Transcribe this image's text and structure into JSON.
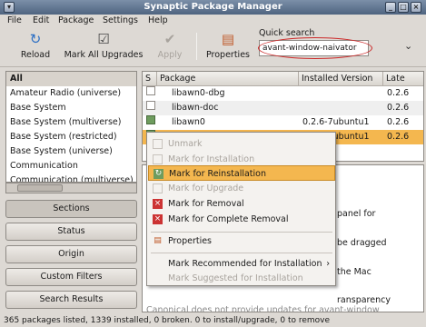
{
  "window": {
    "title": "Synaptic Package Manager"
  },
  "menubar": [
    "File",
    "Edit",
    "Package",
    "Settings",
    "Help"
  ],
  "toolbar": {
    "reload": "Reload",
    "mark_all": "Mark All Upgrades",
    "apply": "Apply",
    "properties": "Properties"
  },
  "search": {
    "label": "Quick search",
    "value": "avant-window-naivator"
  },
  "categories": [
    "All",
    "Amateur Radio (universe)",
    "Base System",
    "Base System (multiverse)",
    "Base System (restricted)",
    "Base System (universe)",
    "Communication",
    "Communication (multiverse)"
  ],
  "left_buttons": [
    "Sections",
    "Status",
    "Origin",
    "Custom Filters",
    "Search Results"
  ],
  "table": {
    "headers": [
      "S",
      "Package",
      "Installed Version",
      "Late"
    ],
    "rows": [
      {
        "name": "libawn0-dbg",
        "installed": "",
        "latest": "0.2.6"
      },
      {
        "name": "libawn-doc",
        "installed": "",
        "latest": "0.2.6"
      },
      {
        "name": "libawn0",
        "installed": "0.2.6-7ubuntu1",
        "latest": "0.2.6"
      },
      {
        "name": "",
        "installed": "0.2.6-7ubuntu1",
        "latest": "0.2.6"
      }
    ]
  },
  "description": {
    "lines": [
      "panel for",
      "be dragged",
      "the Mac",
      "ransparency",
      "Canonical does not provide updates for avant-window"
    ]
  },
  "context_menu": {
    "unmark": "Unmark",
    "install": "Mark for Installation",
    "reinstall": "Mark for Reinstallation",
    "upgrade": "Mark for Upgrade",
    "removal": "Mark for Removal",
    "complete_removal": "Mark for Complete Removal",
    "properties": "Properties",
    "recommended": "Mark Recommended for Installation",
    "suggested": "Mark Suggested for Installation"
  },
  "status": "365 packages listed, 1339 installed, 0 broken. 0 to install/upgrade, 0 to remove",
  "colors": {
    "highlight": "#f4b74f",
    "installed_check": "#6e9c5e",
    "oval": "#cc2a2a"
  }
}
